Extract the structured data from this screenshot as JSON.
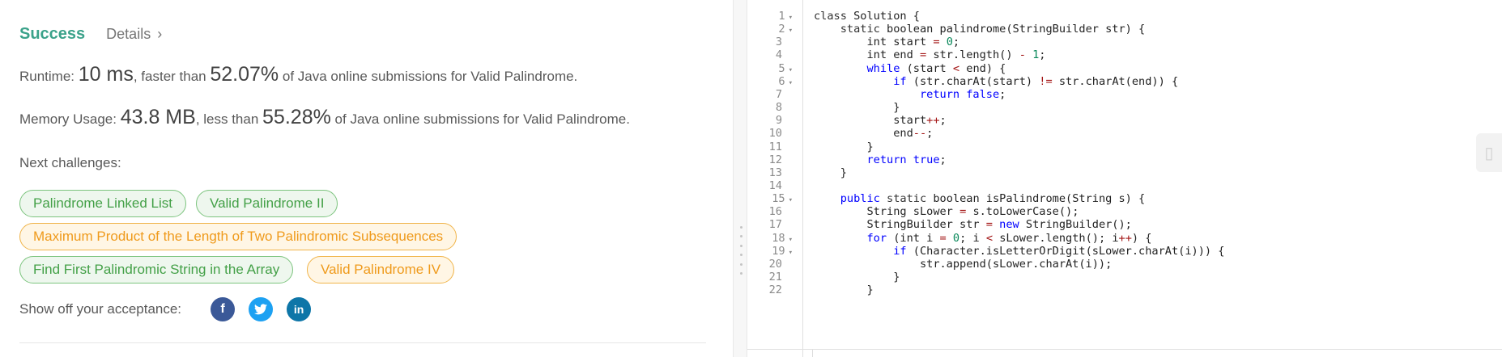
{
  "result": {
    "status": "Success",
    "details_label": "Details",
    "runtime": {
      "label": "Runtime: ",
      "value": "10 ms",
      "mid": ", faster than ",
      "percent": "52.07%",
      "tail": " of Java online submissions for Valid Palindrome."
    },
    "memory": {
      "label": "Memory Usage: ",
      "value": "43.8 MB",
      "mid": ", less than ",
      "percent": "55.28%",
      "tail": " of Java online submissions for Valid Palindrome."
    },
    "next_label": "Next challenges:",
    "challenges": [
      {
        "label": "Palindrome Linked List",
        "difficulty": "easy"
      },
      {
        "label": "Valid Palindrome II",
        "difficulty": "easy"
      },
      {
        "label": "Maximum Product of the Length of Two Palindromic Subsequences",
        "difficulty": "medium"
      },
      {
        "label": "Find First Palindromic String in the Array",
        "difficulty": "easy"
      },
      {
        "label": "Valid Palindrome IV",
        "difficulty": "medium"
      }
    ],
    "share_label": "Show off your acceptance:",
    "social": {
      "facebook": "f",
      "twitter": "t",
      "linkedin": "in"
    }
  },
  "colors": {
    "success": "#3ba28a",
    "easy": "#43a047",
    "medium": "#ef9a1b",
    "keyword": "#0000ff"
  },
  "editor": {
    "line_numbers": [
      "1",
      "2",
      "3",
      "4",
      "5",
      "6",
      "7",
      "8",
      "9",
      "10",
      "11",
      "12",
      "13",
      "14",
      "15",
      "16",
      "17",
      "18",
      "19",
      "20",
      "21",
      "22"
    ],
    "foldable_lines": [
      "1",
      "2",
      "5",
      "6",
      "15",
      "18",
      "19"
    ],
    "lines": [
      "class Solution {",
      "    static boolean palindrome(StringBuilder str) {",
      "        int start = 0;",
      "        int end = str.length() - 1;",
      "        while (start < end) {",
      "            if (str.charAt(start) != str.charAt(end)) {",
      "                return false;",
      "            }",
      "            start++;",
      "            end--;",
      "        }",
      "        return true;",
      "    }",
      "",
      "    public static boolean isPalindrome(String s) {",
      "        String sLower = s.toLowerCase();",
      "        StringBuilder str = new StringBuilder();",
      "        for (int i = 0; i < sLower.length(); i++) {",
      "            if (Character.isLetterOrDigit(sLower.charAt(i))) {",
      "                str.append(sLower.charAt(i));",
      "            }",
      "        }"
    ]
  }
}
